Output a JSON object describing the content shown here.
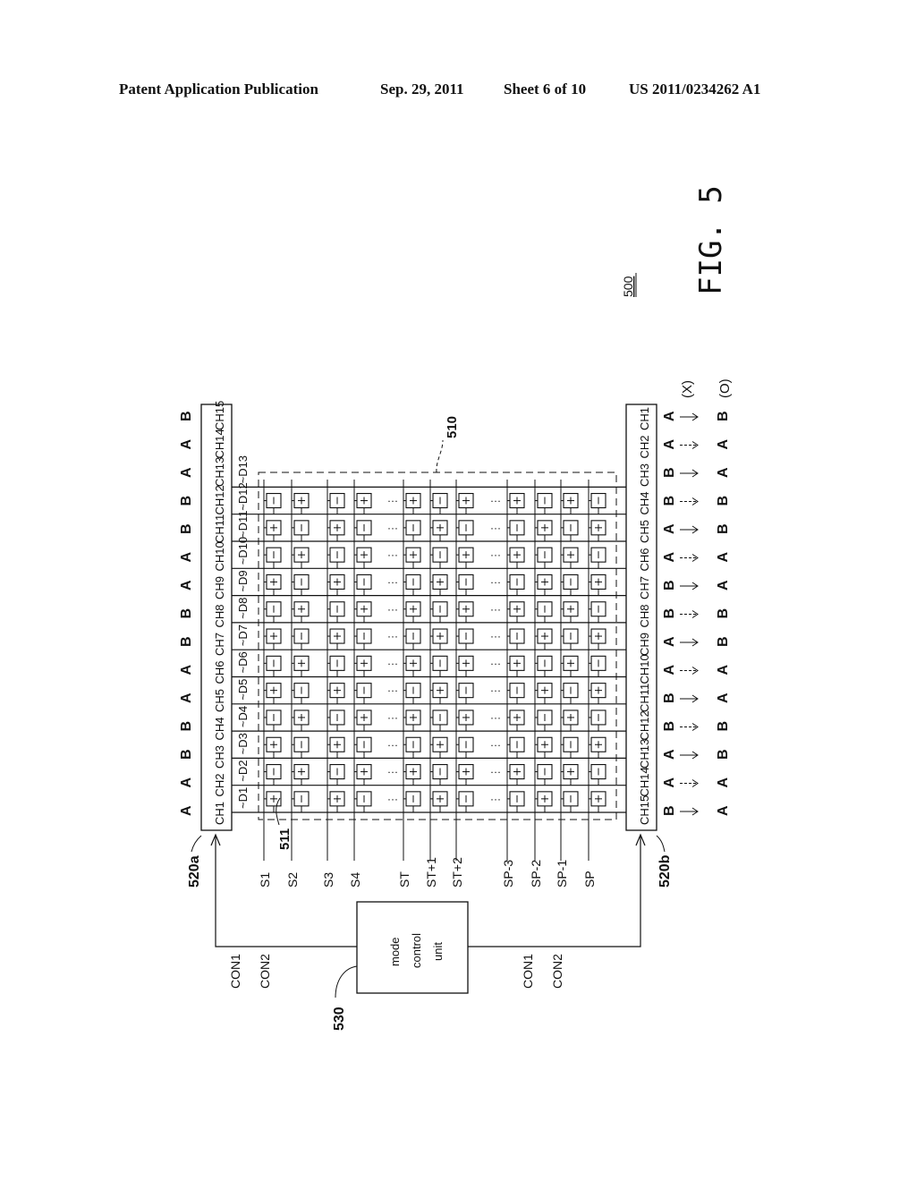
{
  "header": {
    "publication": "Patent Application Publication",
    "date": "Sep. 29, 2011",
    "sheet": "Sheet 6 of 10",
    "number": "US 2011/0234262 A1"
  },
  "figure": {
    "label": "FIG. 5",
    "ref_number": "500",
    "panel_ref": "510",
    "pixel_ref": "511",
    "driver_top_ref": "520a",
    "driver_bottom_ref": "520b",
    "control_ref": "530",
    "control_unit_lines": [
      "mode",
      "control",
      "unit"
    ],
    "control_signals_top": [
      "CON1",
      "CON2"
    ],
    "control_signals_bottom": [
      "CON1",
      "CON2"
    ],
    "top_channels": [
      "CH1",
      "CH2",
      "CH3",
      "CH4",
      "CH5",
      "CH6",
      "CH7",
      "CH8",
      "CH9",
      "CH10",
      "CH11",
      "CH12",
      "CH13",
      "CH14",
      "CH15"
    ],
    "bottom_channels": [
      "CH15",
      "CH14",
      "CH13",
      "CH12",
      "CH11",
      "CH10",
      "CH9",
      "CH8",
      "CH7",
      "CH6",
      "CH5",
      "CH4",
      "CH3",
      "CH2",
      "CH1"
    ],
    "data_lines": [
      "D1",
      "D2",
      "D3",
      "D4",
      "D5",
      "D6",
      "D7",
      "D8",
      "D9",
      "D10",
      "D11",
      "D12",
      "D13"
    ],
    "scan_lines": [
      "S1",
      "S2",
      "S3",
      "S4",
      "ST",
      "ST+1",
      "ST+2",
      "SP-3",
      "SP-2",
      "SP-1",
      "SP"
    ],
    "top_modes": [
      "A",
      "A",
      "B",
      "B",
      "A",
      "A",
      "B",
      "B",
      "A",
      "A",
      "B",
      "B",
      "A",
      "A",
      "B"
    ],
    "bottom_transitions": [
      {
        "from": "B",
        "to": "A",
        "dashed": false
      },
      {
        "from": "A",
        "to": "A",
        "dashed": true
      },
      {
        "from": "A",
        "to": "B",
        "dashed": false
      },
      {
        "from": "B",
        "to": "B",
        "dashed": true
      },
      {
        "from": "B",
        "to": "A",
        "dashed": false
      },
      {
        "from": "A",
        "to": "A",
        "dashed": true
      },
      {
        "from": "A",
        "to": "B",
        "dashed": false
      },
      {
        "from": "B",
        "to": "B",
        "dashed": true
      },
      {
        "from": "B",
        "to": "A",
        "dashed": false
      },
      {
        "from": "A",
        "to": "A",
        "dashed": true
      },
      {
        "from": "A",
        "to": "B",
        "dashed": false
      },
      {
        "from": "B",
        "to": "B",
        "dashed": true
      },
      {
        "from": "B",
        "to": "A",
        "dashed": false
      },
      {
        "from": "A",
        "to": "A",
        "dashed": true
      },
      {
        "from": "A",
        "to": "B",
        "dashed": false
      }
    ],
    "legend_x": "(X)",
    "legend_o": "(O)",
    "ellipsis": "···",
    "polarity_first_row": [
      "+",
      "-",
      "+",
      "-",
      "-",
      "+",
      "-",
      "-",
      "+",
      "-",
      "+"
    ]
  }
}
